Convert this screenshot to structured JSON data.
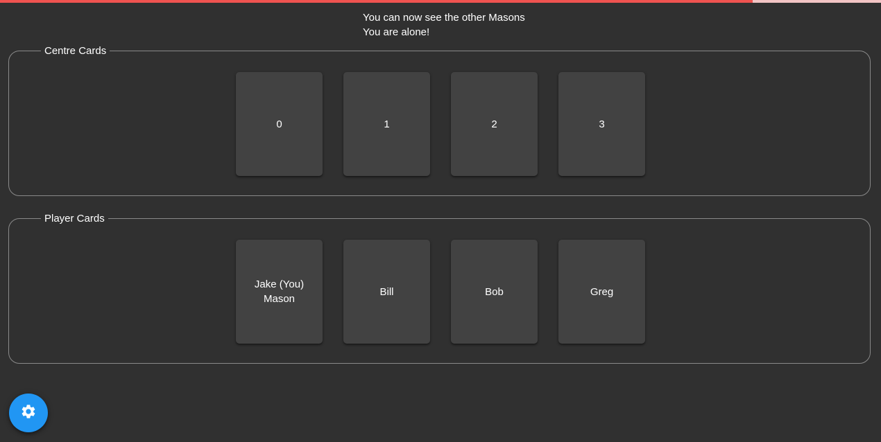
{
  "timer": {
    "progress": 0.854,
    "fill_color": "#ef5350",
    "track_color": "#f2c4c4"
  },
  "status": {
    "line1": "You can now see the other Masons",
    "line2": "You are alone!"
  },
  "centre": {
    "legend": "Centre Cards",
    "cards": [
      {
        "label": "0"
      },
      {
        "label": "1"
      },
      {
        "label": "2"
      },
      {
        "label": "3"
      }
    ]
  },
  "players": {
    "legend": "Player Cards",
    "cards": [
      {
        "label": "Jake (You)",
        "role": "Mason"
      },
      {
        "label": "Bill",
        "role": ""
      },
      {
        "label": "Bob",
        "role": ""
      },
      {
        "label": "Greg",
        "role": ""
      }
    ]
  },
  "settings_button": {
    "icon": "gear-icon",
    "color": "#2196f3"
  }
}
